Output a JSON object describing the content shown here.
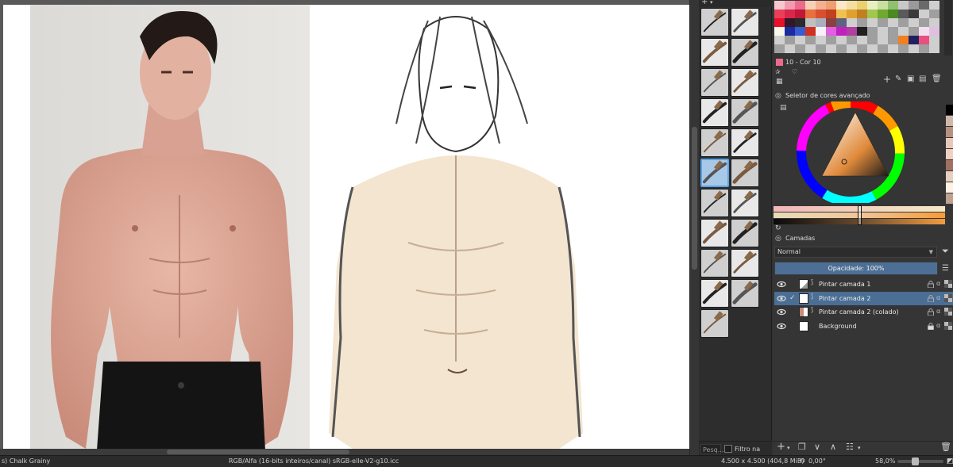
{
  "canvas": {
    "document_bg": "#ffffff",
    "reference_photo": "shirtless-male-reference",
    "sketch": "anime-torso-sketch"
  },
  "brush_presets": {
    "filter_placeholder": "Pesq...",
    "tag_filter_label": "Filtro na tag",
    "tiles": [
      "eraser-brush",
      "airbrush-soft",
      "ink-pen",
      "smudge-blender",
      "ink-fine-pen",
      "marker-brush",
      "pencil-brush",
      "pencil-2b",
      "bristle-brush",
      "fine-liner",
      "chalk-brush",
      "watercolor-wet",
      "wet-paint",
      "water-blend",
      "texture-leaf",
      "pixel-brush",
      "stamp-brush",
      "glitter-brush",
      "dot-texture",
      "splatter-texture",
      "spray-dots"
    ]
  },
  "palette": {
    "current_color_name": "10 - Cor 10",
    "current_color": "#ec6b8c"
  },
  "color_selector": {
    "title": "Seletor de cores avançado"
  },
  "layers": {
    "title": "Camadas",
    "blend_mode": "Normal",
    "opacity_label": "Opacidade:  100%",
    "items": [
      {
        "name": "Pintar camada 1",
        "active": false,
        "checked": ""
      },
      {
        "name": "Pintar camada 2",
        "active": true,
        "checked": "✓"
      },
      {
        "name": "Pintar camada 2 (colado)",
        "active": false,
        "checked": ""
      },
      {
        "name": "Background",
        "active": false,
        "checked": ""
      }
    ]
  },
  "status": {
    "brush": "s) Chalk Grainy",
    "color_space": "RGB/Alfa (16-bits inteiros/canal)  sRGB-elle-V2-g10.icc",
    "image_size": "4.500 x 4.500 (404,8 MiB)",
    "rotation": "0,00°",
    "zoom": "58,0%"
  }
}
